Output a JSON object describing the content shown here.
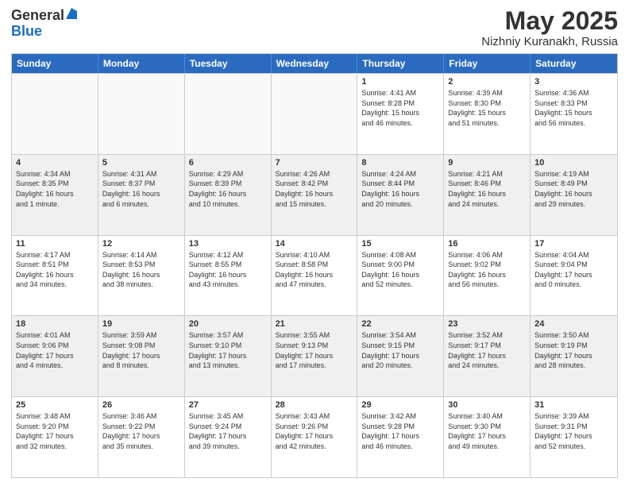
{
  "header": {
    "logo_general": "General",
    "logo_blue": "Blue",
    "month_title": "May 2025",
    "subtitle": "Nizhniy Kuranakh, Russia"
  },
  "weekdays": [
    "Sunday",
    "Monday",
    "Tuesday",
    "Wednesday",
    "Thursday",
    "Friday",
    "Saturday"
  ],
  "rows": [
    [
      {
        "day": "",
        "lines": [],
        "empty": true
      },
      {
        "day": "",
        "lines": [],
        "empty": true
      },
      {
        "day": "",
        "lines": [],
        "empty": true
      },
      {
        "day": "",
        "lines": [],
        "empty": true
      },
      {
        "day": "1",
        "lines": [
          "Sunrise: 4:41 AM",
          "Sunset: 8:28 PM",
          "Daylight: 15 hours",
          "and 46 minutes."
        ]
      },
      {
        "day": "2",
        "lines": [
          "Sunrise: 4:39 AM",
          "Sunset: 8:30 PM",
          "Daylight: 15 hours",
          "and 51 minutes."
        ]
      },
      {
        "day": "3",
        "lines": [
          "Sunrise: 4:36 AM",
          "Sunset: 8:33 PM",
          "Daylight: 15 hours",
          "and 56 minutes."
        ]
      }
    ],
    [
      {
        "day": "4",
        "lines": [
          "Sunrise: 4:34 AM",
          "Sunset: 8:35 PM",
          "Daylight: 16 hours",
          "and 1 minute."
        ],
        "shaded": true
      },
      {
        "day": "5",
        "lines": [
          "Sunrise: 4:31 AM",
          "Sunset: 8:37 PM",
          "Daylight: 16 hours",
          "and 6 minutes."
        ],
        "shaded": true
      },
      {
        "day": "6",
        "lines": [
          "Sunrise: 4:29 AM",
          "Sunset: 8:39 PM",
          "Daylight: 16 hours",
          "and 10 minutes."
        ],
        "shaded": true
      },
      {
        "day": "7",
        "lines": [
          "Sunrise: 4:26 AM",
          "Sunset: 8:42 PM",
          "Daylight: 16 hours",
          "and 15 minutes."
        ],
        "shaded": true
      },
      {
        "day": "8",
        "lines": [
          "Sunrise: 4:24 AM",
          "Sunset: 8:44 PM",
          "Daylight: 16 hours",
          "and 20 minutes."
        ],
        "shaded": true
      },
      {
        "day": "9",
        "lines": [
          "Sunrise: 4:21 AM",
          "Sunset: 8:46 PM",
          "Daylight: 16 hours",
          "and 24 minutes."
        ],
        "shaded": true
      },
      {
        "day": "10",
        "lines": [
          "Sunrise: 4:19 AM",
          "Sunset: 8:49 PM",
          "Daylight: 16 hours",
          "and 29 minutes."
        ],
        "shaded": true
      }
    ],
    [
      {
        "day": "11",
        "lines": [
          "Sunrise: 4:17 AM",
          "Sunset: 8:51 PM",
          "Daylight: 16 hours",
          "and 34 minutes."
        ]
      },
      {
        "day": "12",
        "lines": [
          "Sunrise: 4:14 AM",
          "Sunset: 8:53 PM",
          "Daylight: 16 hours",
          "and 38 minutes."
        ]
      },
      {
        "day": "13",
        "lines": [
          "Sunrise: 4:12 AM",
          "Sunset: 8:55 PM",
          "Daylight: 16 hours",
          "and 43 minutes."
        ]
      },
      {
        "day": "14",
        "lines": [
          "Sunrise: 4:10 AM",
          "Sunset: 8:58 PM",
          "Daylight: 16 hours",
          "and 47 minutes."
        ]
      },
      {
        "day": "15",
        "lines": [
          "Sunrise: 4:08 AM",
          "Sunset: 9:00 PM",
          "Daylight: 16 hours",
          "and 52 minutes."
        ]
      },
      {
        "day": "16",
        "lines": [
          "Sunrise: 4:06 AM",
          "Sunset: 9:02 PM",
          "Daylight: 16 hours",
          "and 56 minutes."
        ]
      },
      {
        "day": "17",
        "lines": [
          "Sunrise: 4:04 AM",
          "Sunset: 9:04 PM",
          "Daylight: 17 hours",
          "and 0 minutes."
        ]
      }
    ],
    [
      {
        "day": "18",
        "lines": [
          "Sunrise: 4:01 AM",
          "Sunset: 9:06 PM",
          "Daylight: 17 hours",
          "and 4 minutes."
        ],
        "shaded": true
      },
      {
        "day": "19",
        "lines": [
          "Sunrise: 3:59 AM",
          "Sunset: 9:08 PM",
          "Daylight: 17 hours",
          "and 8 minutes."
        ],
        "shaded": true
      },
      {
        "day": "20",
        "lines": [
          "Sunrise: 3:57 AM",
          "Sunset: 9:10 PM",
          "Daylight: 17 hours",
          "and 13 minutes."
        ],
        "shaded": true
      },
      {
        "day": "21",
        "lines": [
          "Sunrise: 3:55 AM",
          "Sunset: 9:13 PM",
          "Daylight: 17 hours",
          "and 17 minutes."
        ],
        "shaded": true
      },
      {
        "day": "22",
        "lines": [
          "Sunrise: 3:54 AM",
          "Sunset: 9:15 PM",
          "Daylight: 17 hours",
          "and 20 minutes."
        ],
        "shaded": true
      },
      {
        "day": "23",
        "lines": [
          "Sunrise: 3:52 AM",
          "Sunset: 9:17 PM",
          "Daylight: 17 hours",
          "and 24 minutes."
        ],
        "shaded": true
      },
      {
        "day": "24",
        "lines": [
          "Sunrise: 3:50 AM",
          "Sunset: 9:19 PM",
          "Daylight: 17 hours",
          "and 28 minutes."
        ],
        "shaded": true
      }
    ],
    [
      {
        "day": "25",
        "lines": [
          "Sunrise: 3:48 AM",
          "Sunset: 9:20 PM",
          "Daylight: 17 hours",
          "and 32 minutes."
        ]
      },
      {
        "day": "26",
        "lines": [
          "Sunrise: 3:46 AM",
          "Sunset: 9:22 PM",
          "Daylight: 17 hours",
          "and 35 minutes."
        ]
      },
      {
        "day": "27",
        "lines": [
          "Sunrise: 3:45 AM",
          "Sunset: 9:24 PM",
          "Daylight: 17 hours",
          "and 39 minutes."
        ]
      },
      {
        "day": "28",
        "lines": [
          "Sunrise: 3:43 AM",
          "Sunset: 9:26 PM",
          "Daylight: 17 hours",
          "and 42 minutes."
        ]
      },
      {
        "day": "29",
        "lines": [
          "Sunrise: 3:42 AM",
          "Sunset: 9:28 PM",
          "Daylight: 17 hours",
          "and 46 minutes."
        ]
      },
      {
        "day": "30",
        "lines": [
          "Sunrise: 3:40 AM",
          "Sunset: 9:30 PM",
          "Daylight: 17 hours",
          "and 49 minutes."
        ]
      },
      {
        "day": "31",
        "lines": [
          "Sunrise: 3:39 AM",
          "Sunset: 9:31 PM",
          "Daylight: 17 hours",
          "and 52 minutes."
        ]
      }
    ]
  ]
}
